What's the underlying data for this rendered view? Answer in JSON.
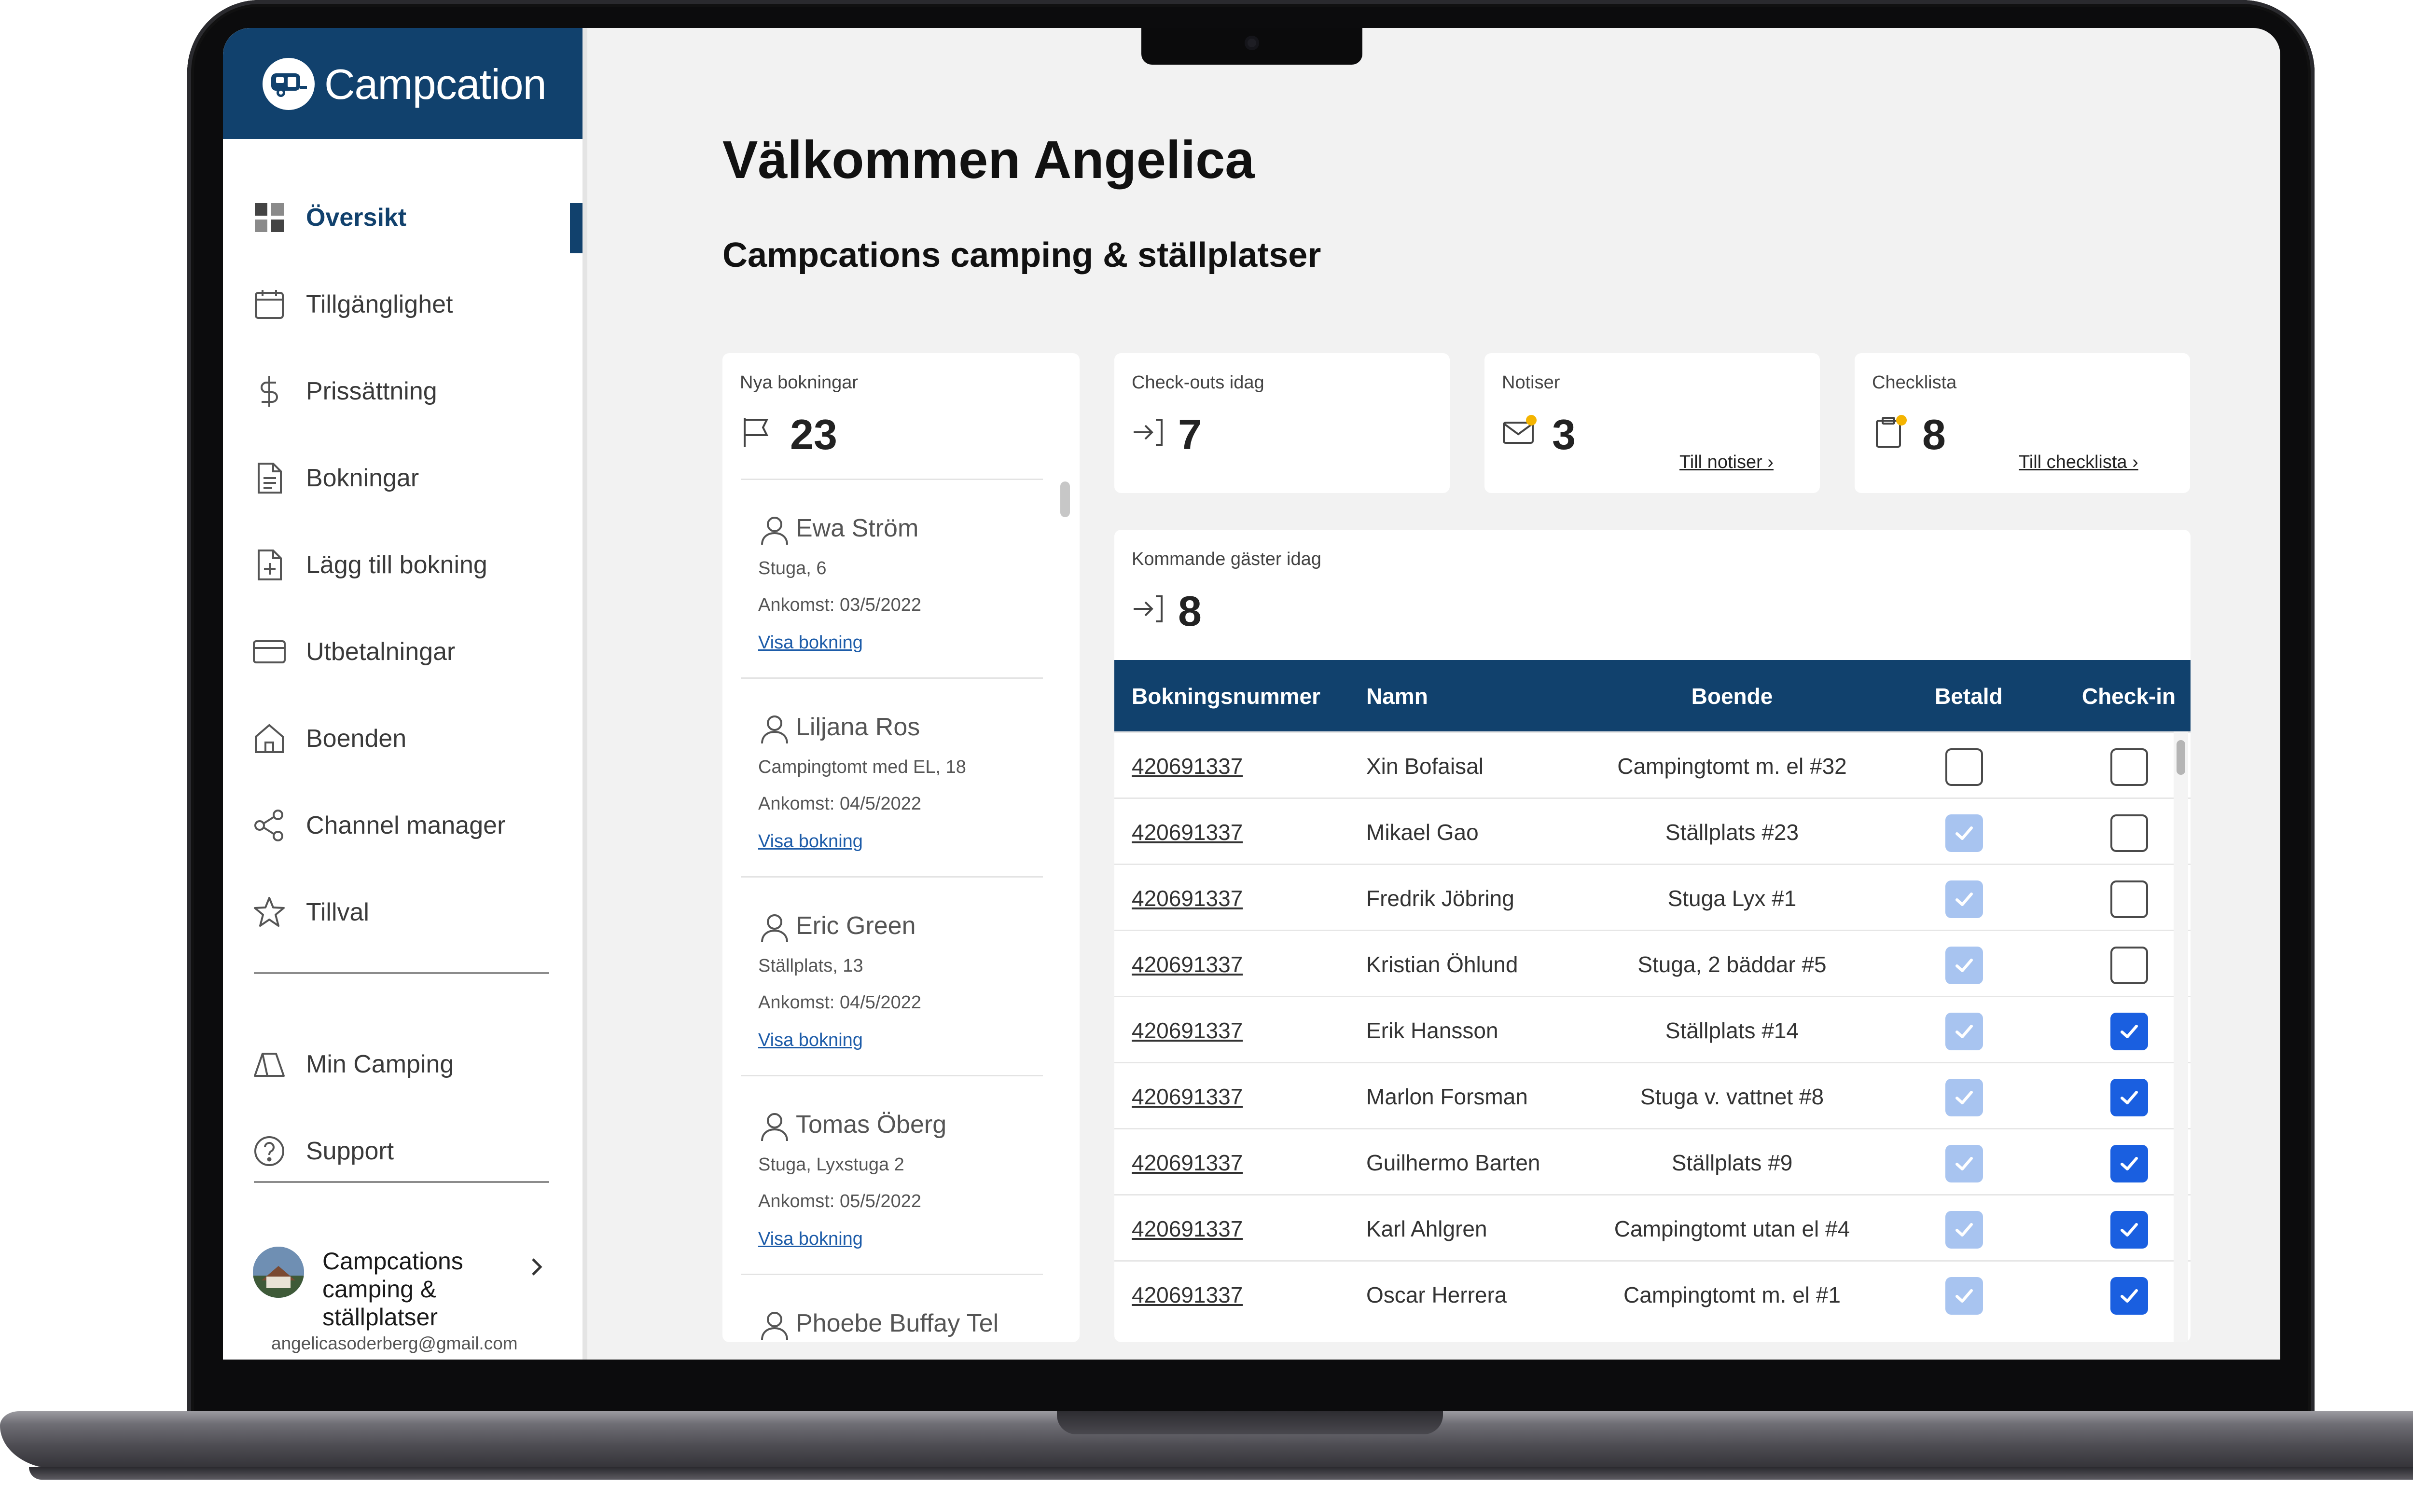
{
  "app": {
    "name": "Campcation"
  },
  "sidebar": {
    "items": [
      {
        "label": "Översikt",
        "icon": "dashboard-icon",
        "active": true
      },
      {
        "label": "Tillgänglighet",
        "icon": "calendar-icon"
      },
      {
        "label": "Prissättning",
        "icon": "dollar-icon"
      },
      {
        "label": "Bokningar",
        "icon": "document-icon"
      },
      {
        "label": "Lägg till bokning",
        "icon": "add-document-icon"
      },
      {
        "label": "Utbetalningar",
        "icon": "credit-card-icon"
      },
      {
        "label": "Boenden",
        "icon": "home-icon"
      },
      {
        "label": "Channel manager",
        "icon": "share-icon"
      },
      {
        "label": "Tillval",
        "icon": "star-icon"
      }
    ],
    "bottom_items": [
      {
        "label": "Min Camping",
        "icon": "tent-icon"
      },
      {
        "label": "Support",
        "icon": "help-icon"
      }
    ],
    "profile": {
      "name": "Campcations camping & ställplatser",
      "email": "angelicasoderberg@gmail.com"
    }
  },
  "main": {
    "welcome": "Välkommen Angelica",
    "subtitle": "Campcations camping & ställplatser"
  },
  "cards": {
    "new_bookings": {
      "title": "Nya bokningar",
      "value": "23"
    },
    "checkouts": {
      "title": "Check-outs idag",
      "value": "7"
    },
    "notifications": {
      "title": "Notiser",
      "value": "3",
      "link": "Till notiser ›"
    },
    "checklist": {
      "title": "Checklista",
      "value": "8",
      "link": "Till checklista ›"
    },
    "arrivals": {
      "title": "Kommande gäster idag",
      "value": "8"
    }
  },
  "bookings": [
    {
      "name": "Ewa Ström",
      "place": "Stuga, 6",
      "date": "Ankomst: 03/5/2022",
      "link": "Visa bokning"
    },
    {
      "name": "Liljana Ros",
      "place": "Campingtomt med EL, 18",
      "date": "Ankomst: 04/5/2022",
      "link": "Visa bokning"
    },
    {
      "name": "Eric Green",
      "place": "Ställplats, 13",
      "date": "Ankomst: 04/5/2022",
      "link": "Visa bokning"
    },
    {
      "name": "Tomas Öberg",
      "place": "Stuga, Lyxstuga 2",
      "date": "Ankomst: 05/5/2022",
      "link": "Visa bokning"
    },
    {
      "name": "Phoebe Buffay Tel",
      "place": "",
      "date": "",
      "link": ""
    }
  ],
  "guests": {
    "headers": [
      "Bokningsnummer",
      "Namn",
      "Boende",
      "Betald",
      "Check-in"
    ],
    "rows": [
      {
        "number": "420691337",
        "name": "Xin Bofaisal",
        "boende": "Campingtomt m. el #32",
        "paid": false,
        "checkin": false
      },
      {
        "number": "420691337",
        "name": "Mikael Gao",
        "boende": "Ställplats #23",
        "paid": true,
        "checkin": false
      },
      {
        "number": "420691337",
        "name": "Fredrik Jöbring",
        "boende": "Stuga Lyx #1",
        "paid": true,
        "checkin": false
      },
      {
        "number": "420691337",
        "name": "Kristian Öhlund",
        "boende": "Stuga, 2 bäddar #5",
        "paid": true,
        "checkin": false
      },
      {
        "number": "420691337",
        "name": "Erik Hansson",
        "boende": "Ställplats #14",
        "paid": true,
        "checkin": true
      },
      {
        "number": "420691337",
        "name": "Marlon Forsman",
        "boende": "Stuga v. vattnet #8",
        "paid": true,
        "checkin": true
      },
      {
        "number": "420691337",
        "name": "Guilhermo Barten",
        "boende": "Ställplats #9",
        "paid": true,
        "checkin": true
      },
      {
        "number": "420691337",
        "name": "Karl Ahlgren",
        "boende": "Campingtomt utan el #4",
        "paid": true,
        "checkin": true
      },
      {
        "number": "420691337",
        "name": "Oscar Herrera",
        "boende": "Campingtomt m. el #1",
        "paid": true,
        "checkin": true
      }
    ]
  },
  "colors": {
    "brand": "#11416d",
    "checkbox_on": "#1a5fe0",
    "checkbox_paid": "#a8c4f0",
    "notification_dot": "#f4b400"
  }
}
